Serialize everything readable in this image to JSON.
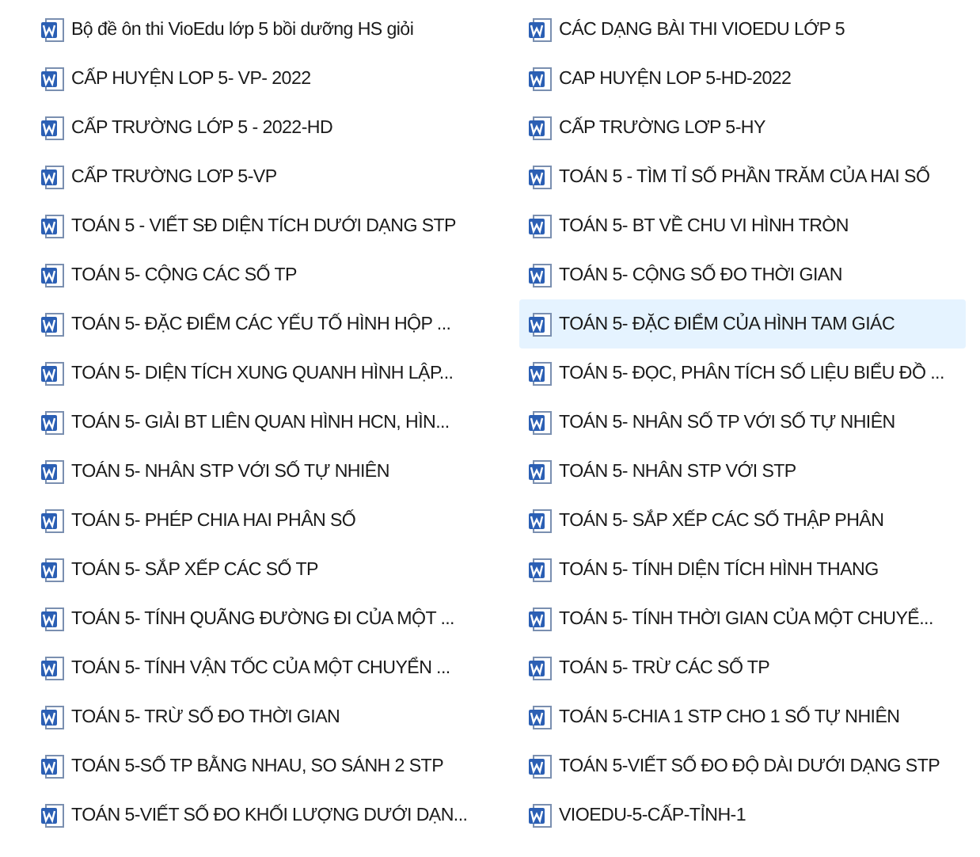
{
  "columns": [
    {
      "items": [
        {
          "name": "Bộ đề ôn thi VioEdu lớp 5 bồi dưỡng HS giỏi",
          "selected": false
        },
        {
          "name": "CẤP HUYỆN LOP 5- VP- 2022",
          "selected": false
        },
        {
          "name": "CẤP TRƯỜNG LỚP 5 - 2022-HD",
          "selected": false
        },
        {
          "name": "CẤP TRƯỜNG LƠP 5-VP",
          "selected": false
        },
        {
          "name": "TOÁN 5 - VIẾT SĐ DIỆN TÍCH DƯỚI DẠNG STP",
          "selected": false
        },
        {
          "name": "TOÁN 5- CỘNG CÁC SỐ TP",
          "selected": false
        },
        {
          "name": "TOÁN 5- ĐẶC ĐIỂM CÁC YẾU TỐ HÌNH HỘP ...",
          "selected": false
        },
        {
          "name": "TOÁN 5- DIỆN TÍCH XUNG QUANH HÌNH LẬP...",
          "selected": false
        },
        {
          "name": "TOÁN 5- GIẢI BT LIÊN QUAN HÌNH HCN, HÌN...",
          "selected": false
        },
        {
          "name": "TOÁN 5- NHÂN STP VỚI SỐ TỰ NHIÊN",
          "selected": false
        },
        {
          "name": "TOÁN 5- PHÉP CHIA HAI PHÂN SỐ",
          "selected": false
        },
        {
          "name": "TOÁN 5- SẮP XẾP CÁC SỐ TP",
          "selected": false
        },
        {
          "name": "TOÁN 5- TÍNH QUÃNG ĐƯỜNG ĐI CỦA MỘT ...",
          "selected": false
        },
        {
          "name": "TOÁN 5- TÍNH VẬN TỐC CỦA MỘT CHUYỂN ...",
          "selected": false
        },
        {
          "name": "TOÁN 5- TRỪ SỐ ĐO THỜI GIAN",
          "selected": false
        },
        {
          "name": "TOÁN 5-SỐ TP BẰNG NHAU, SO SÁNH 2 STP",
          "selected": false
        },
        {
          "name": "TOÁN 5-VIẾT SỐ ĐO KHỐI LƯỢNG DƯỚI DẠN...",
          "selected": false
        }
      ]
    },
    {
      "items": [
        {
          "name": "CÁC DẠNG BÀI THI VIOEDU  LỚP 5",
          "selected": false
        },
        {
          "name": "CAP HUYỆN LOP 5-HD-2022",
          "selected": false
        },
        {
          "name": "CẤP TRƯỜNG LƠP 5-HY",
          "selected": false
        },
        {
          "name": "TOÁN 5 - TÌM TỈ SỐ PHẦN TRĂM CỦA HAI SỐ",
          "selected": false
        },
        {
          "name": "TOÁN 5- BT VỀ CHU VI HÌNH TRÒN",
          "selected": false
        },
        {
          "name": "TOÁN 5- CỘNG SỐ ĐO THỜI GIAN",
          "selected": false
        },
        {
          "name": "TOÁN 5- ĐẶC ĐIỂM CỦA HÌNH TAM GIÁC",
          "selected": true
        },
        {
          "name": "TOÁN 5- ĐỌC, PHÂN TÍCH SỐ LIỆU BIỂU ĐỒ ...",
          "selected": false
        },
        {
          "name": "TOÁN 5- NHÂN SỐ TP VỚI SỐ TỰ NHIÊN",
          "selected": false
        },
        {
          "name": "TOÁN 5- NHÂN STP VỚI STP",
          "selected": false
        },
        {
          "name": "TOÁN 5- SẮP XẾP CÁC SỐ THẬP PHÂN",
          "selected": false
        },
        {
          "name": "TOÁN 5- TÍNH DIỆN TÍCH HÌNH THANG",
          "selected": false
        },
        {
          "name": "TOÁN 5- TÍNH THỜI GIAN CỦA MỘT CHUYỂ...",
          "selected": false
        },
        {
          "name": "TOÁN 5- TRỪ CÁC SỐ TP",
          "selected": false
        },
        {
          "name": "TOÁN 5-CHIA 1 STP CHO 1 SỐ TỰ NHIÊN",
          "selected": false
        },
        {
          "name": "TOÁN 5-VIẾT SỐ ĐO ĐỘ DÀI DƯỚI DẠNG STP",
          "selected": false
        },
        {
          "name": "VIOEDU-5-CẤP-TỈNH-1",
          "selected": false
        }
      ]
    }
  ]
}
